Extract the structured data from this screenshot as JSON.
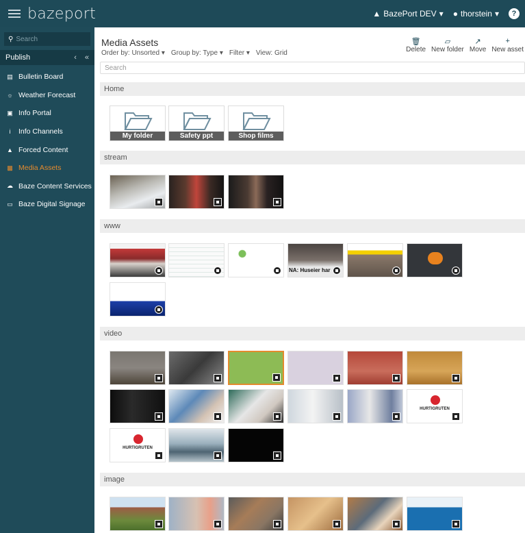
{
  "topbar": {
    "logo": "bazeport",
    "org": "BazePort DEV",
    "user": "thorstein",
    "help": "?"
  },
  "sidebar": {
    "search_placeholder": "Search",
    "publish_label": "Publish",
    "items": [
      {
        "label": "Bulletin Board",
        "icon": "bulletin-icon"
      },
      {
        "label": "Weather Forecast",
        "icon": "sun-icon"
      },
      {
        "label": "Info Portal",
        "icon": "portal-icon"
      },
      {
        "label": "Info Channels",
        "icon": "info-icon"
      },
      {
        "label": "Forced Content",
        "icon": "warning-icon"
      },
      {
        "label": "Media Assets",
        "icon": "media-icon",
        "active": true
      },
      {
        "label": "Baze Content Services",
        "icon": "cloud-icon"
      },
      {
        "label": "Baze Digital Signage",
        "icon": "monitor-icon"
      }
    ]
  },
  "main": {
    "title": "Media Assets",
    "order_by": "Order by: Unsorted",
    "group_by": "Group by: Type",
    "filter": "Filter",
    "view": "View: Grid",
    "actions": [
      "Delete",
      "New folder",
      "Move",
      "New asset"
    ],
    "search_placeholder": "Search",
    "sections": {
      "home": "Home",
      "stream": "stream",
      "www": "www",
      "video": "video",
      "image": "image"
    },
    "folders": [
      "My folder",
      "Safety ppt",
      "Shop films"
    ],
    "hurtigruten_label": "HURTIGRUTEN",
    "www_tile_text": "NA: Huseier har",
    "colors": {
      "accent": "#e48a2e",
      "nav_bg": "#1f4b59",
      "topbar_bg": "#1e4a58"
    }
  }
}
